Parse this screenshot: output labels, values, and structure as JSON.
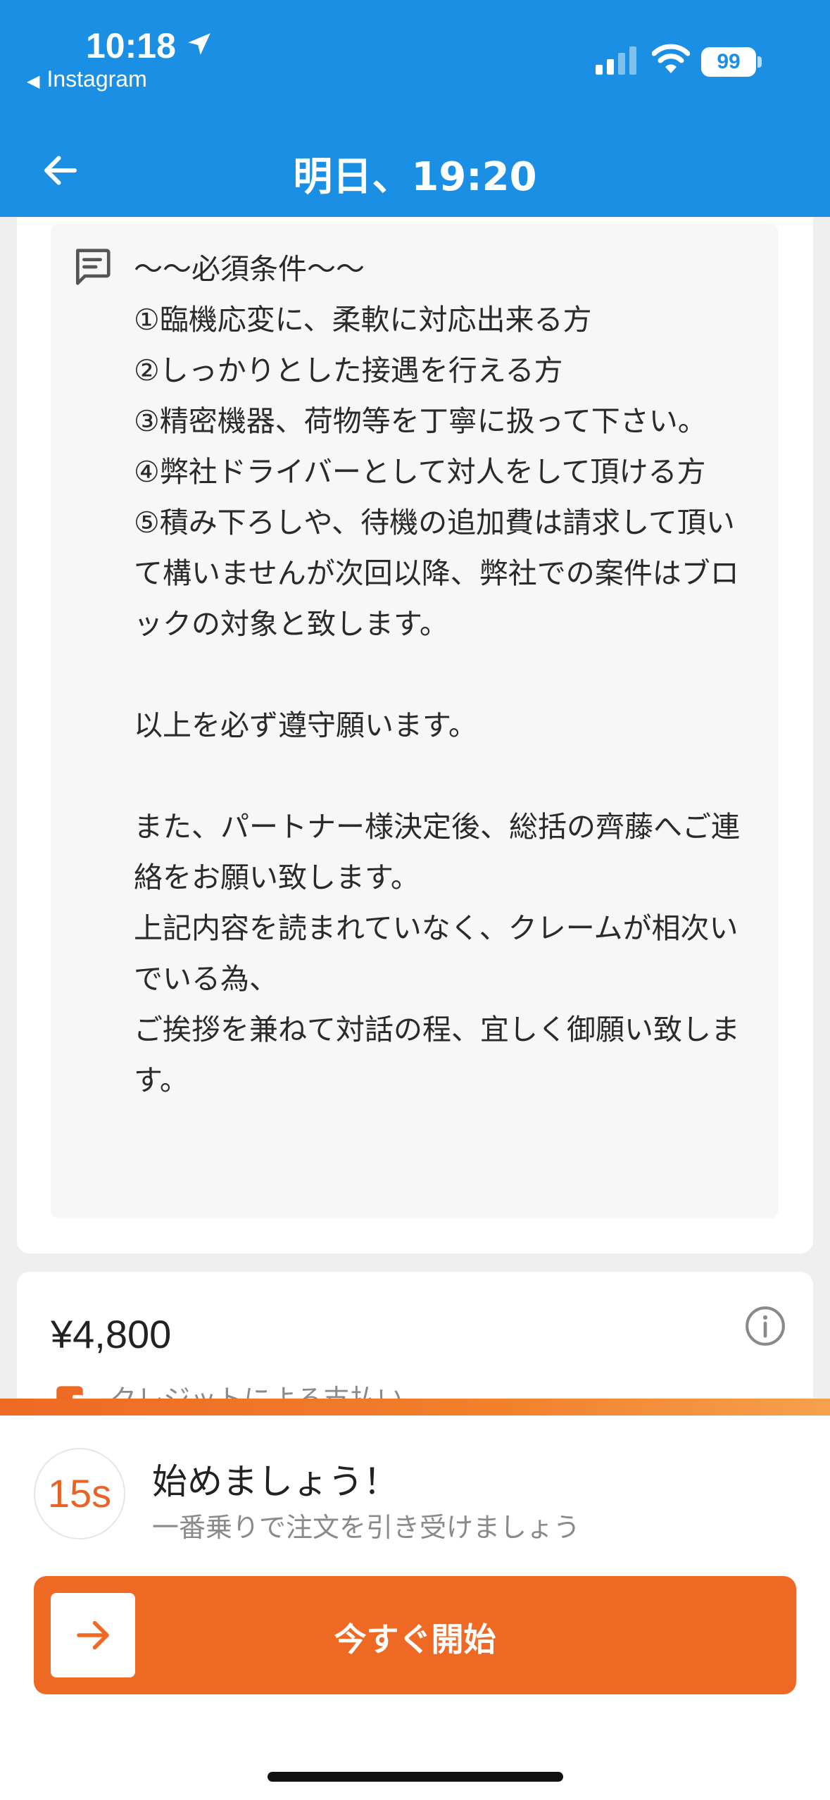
{
  "status_bar": {
    "time": "10:18",
    "back_app": "Instagram",
    "battery": "99",
    "icons": [
      "location-arrow-icon",
      "signal-icon",
      "wifi-icon",
      "battery-icon"
    ]
  },
  "header": {
    "title": "明日、19:20",
    "back_icon": "back-arrow-icon"
  },
  "notes": {
    "icon": "note-icon",
    "text": "〜〜必須条件〜〜\n①臨機応変に、柔軟に対応出来る方\n②しっかりとした接遇を行える方\n③精密機器、荷物等を丁寧に扱って下さい。\n④弊社ドライバーとして対人をして頂ける方\n⑤積み下ろしや、待機の追加費は請求して頂いて構いませんが次回以降、弊社での案件はブロックの対象と致します。\n\n以上を必ず遵守願います。\n\nまた、パートナー様決定後、総括の齊藤へご連絡をお願い致します。\n上記内容を読まれていなく、クレームが相次いでいる為、\nご挨拶を兼ねて対話の程、宜しく御願い致します。"
  },
  "price_card": {
    "price": "¥4,800",
    "payment_method": "クレジットによる支払い",
    "info_icon": "info-icon",
    "payment_icon": "wallet-icon"
  },
  "bottom_sheet": {
    "timer": "15s",
    "title": "始めましょう！",
    "subtitle": "一番乗りで注文を引き受けましょう",
    "button_label": "今すぐ開始",
    "colors": {
      "accent": "#ee6a24",
      "header": "#1a8fe3"
    }
  }
}
